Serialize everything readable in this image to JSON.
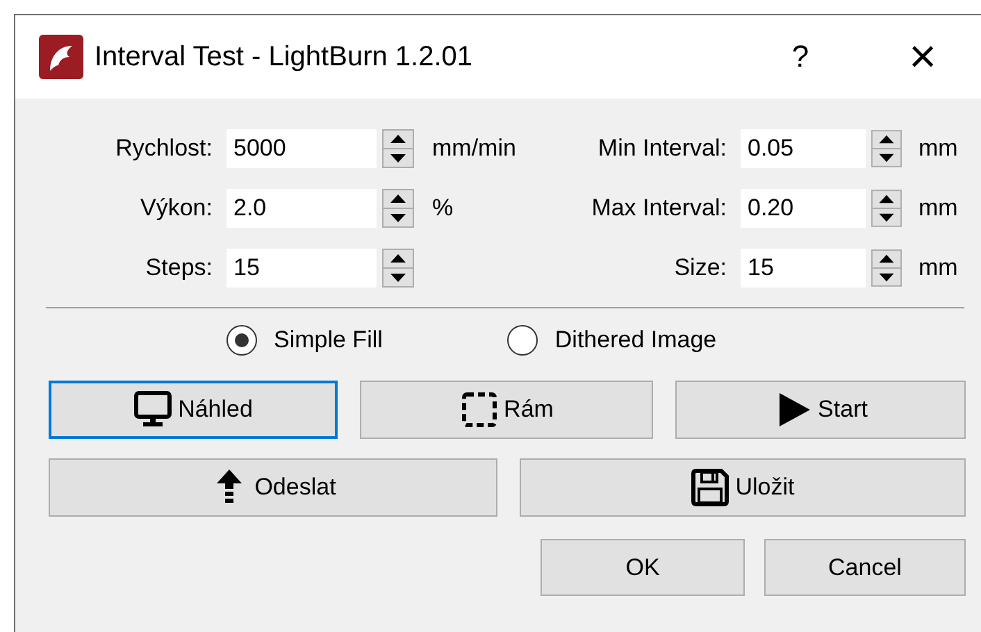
{
  "window": {
    "title": "Interval Test - LightBurn 1.2.01",
    "help": "?",
    "close": "×"
  },
  "fields": [
    {
      "label": "Rychlost:",
      "value": "5000",
      "unit": "mm/min"
    },
    {
      "label": "Min Interval:",
      "value": "0.05",
      "unit": "mm"
    },
    {
      "label": "Výkon:",
      "value": "2.0",
      "unit": "%"
    },
    {
      "label": "Max Interval:",
      "value": "0.20",
      "unit": "mm"
    },
    {
      "label": "Steps:",
      "value": "15"
    },
    {
      "label": "Size:",
      "value": "15",
      "unit": "mm"
    }
  ],
  "modes": [
    {
      "label": "Simple Fill",
      "selected": true
    },
    {
      "label": "Dithered Image",
      "selected": false
    }
  ],
  "actions": [
    {
      "label": "Náhled",
      "kind": "monitor",
      "default": true
    },
    {
      "label": "Rám",
      "kind": "frame",
      "default": false
    },
    {
      "label": "Start",
      "kind": "play",
      "default": false
    }
  ],
  "actions2": [
    {
      "label": "Odeslat",
      "kind": "upload"
    },
    {
      "label": "Uložit",
      "kind": "save"
    }
  ],
  "buttons": [
    "OK",
    "Cancel"
  ]
}
